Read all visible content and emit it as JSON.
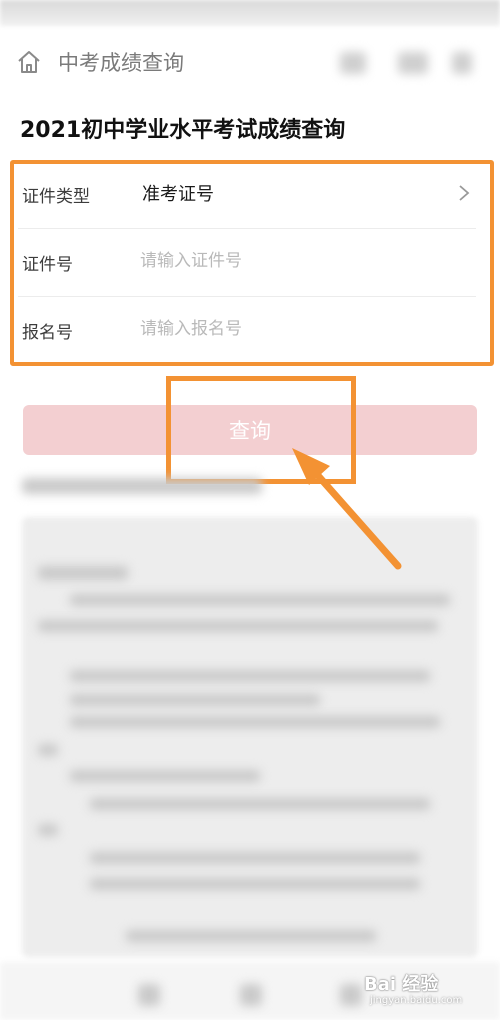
{
  "nav": {
    "title": "中考成绩查询",
    "home_icon": "home-icon"
  },
  "page": {
    "title": "2021初中学业水平考试成绩查询"
  },
  "form": {
    "rows": [
      {
        "label": "证件类型",
        "value": "准考证号"
      },
      {
        "label": "证件号",
        "placeholder": "请输入证件号"
      },
      {
        "label": "报名号",
        "placeholder": "请输入报名号"
      }
    ]
  },
  "query_button": {
    "label": "查询"
  },
  "watermark": {
    "text": "Bai 经验",
    "sub": "jingyan.baidu.com"
  },
  "colors": {
    "highlight": "#f39233",
    "button_bg": "#f3cfd1",
    "placeholder": "#b9b9b9"
  }
}
